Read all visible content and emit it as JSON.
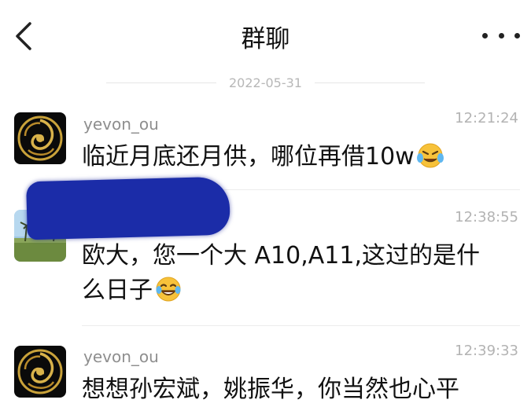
{
  "header": {
    "title": "群聊",
    "back_icon": "chevron-left-icon",
    "more_icon": "more-dots-icon"
  },
  "date_separator": "2022-05-31",
  "messages": [
    {
      "sender": "yevon_ou",
      "time": "12:21:24",
      "text": "临近月底还月供，哪位再借10w",
      "emoji": "crying-laughing-emoji"
    },
    {
      "sender": "",
      "time": "12:38:55",
      "text_line1": "欧大，您一个大 A10,A11,这过的是什",
      "text_line2": "么日子",
      "emoji": "laughing-tears-emoji"
    },
    {
      "sender": "yevon_ou",
      "time": "12:39:33",
      "text": "想想孙宏斌，姚振华，你当然也心平"
    }
  ],
  "colors": {
    "redaction": "#1b2ca8",
    "logo_gold": "#c9a23a"
  }
}
